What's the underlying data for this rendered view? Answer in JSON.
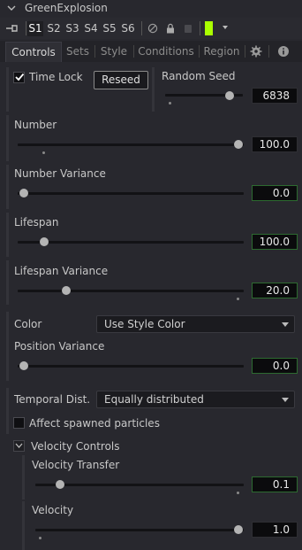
{
  "title": "GreenExplosion",
  "toolbar": {
    "slots": [
      "S1",
      "S2",
      "S3",
      "S4",
      "S5",
      "S6"
    ],
    "active_slot": "S1",
    "color_swatch": "#aaff00"
  },
  "tabs": [
    "Controls",
    "Sets",
    "Style",
    "Conditions",
    "Region"
  ],
  "active_tab": "Controls",
  "controls": {
    "time_lock": {
      "label": "Time Lock",
      "checked": true
    },
    "reseed_label": "Reseed",
    "random_seed": {
      "label": "Random Seed",
      "value": "6838"
    },
    "number": {
      "label": "Number",
      "value": "100.0"
    },
    "number_variance": {
      "label": "Number Variance",
      "value": "0.0"
    },
    "lifespan": {
      "label": "Lifespan",
      "value": "100.0"
    },
    "lifespan_variance": {
      "label": "Lifespan Variance",
      "value": "20.0"
    },
    "color": {
      "label": "Color",
      "value": "Use Style Color"
    },
    "position_variance": {
      "label": "Position Variance",
      "value": "0.0"
    },
    "temporal_dist": {
      "label": "Temporal Dist.",
      "value": "Equally distributed"
    },
    "affect_spawned": {
      "label": "Affect spawned particles",
      "checked": false
    },
    "velocity_controls": {
      "label": "Velocity Controls"
    },
    "velocity_transfer": {
      "label": "Velocity Transfer",
      "value": "0.1"
    },
    "velocity": {
      "label": "Velocity",
      "value": "1.0"
    }
  },
  "colors": {
    "accent_green": "#aaff00",
    "panel_bg": "#28282e",
    "field_bg": "#0b0b0d",
    "nondefault_border": "#2d6a30"
  }
}
